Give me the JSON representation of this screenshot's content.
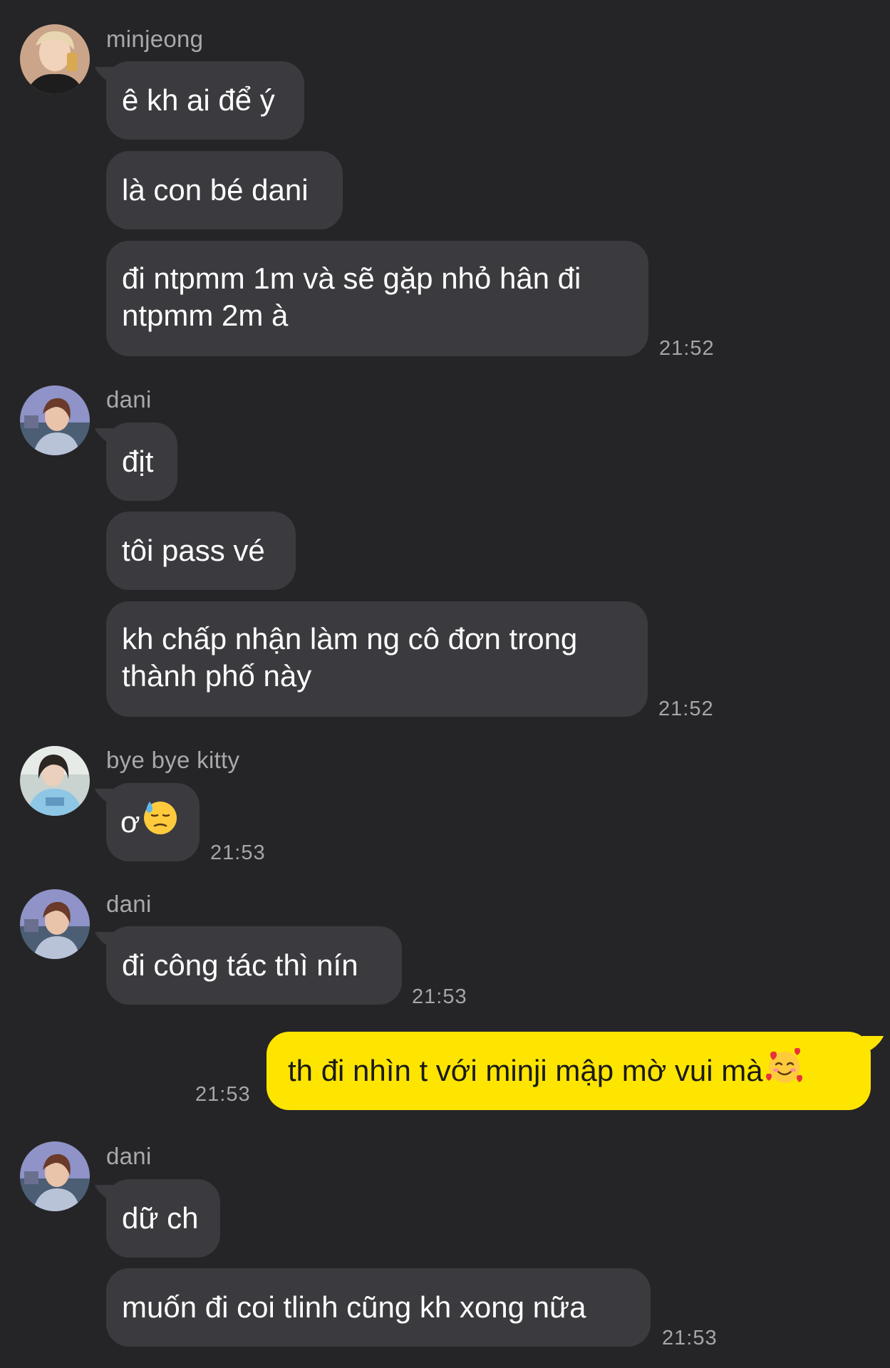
{
  "messages": {
    "g1": {
      "sender": "minjeong",
      "b1": "ê kh ai để ý",
      "b2": "là con bé dani",
      "b3": "đi ntpmm 1m và sẽ gặp nhỏ hân đi ntpmm 2m à",
      "time": "21:52"
    },
    "g2": {
      "sender": "dani",
      "b1": "địt",
      "b2": "tôi pass vé",
      "b3": "kh chấp nhận làm ng cô đơn trong thành phố này",
      "time": "21:52"
    },
    "g3": {
      "sender": "bye bye kitty",
      "b1": "ơ",
      "b1_emoji": "downcast-face-with-sweat-emoji",
      "time": "21:53"
    },
    "g4": {
      "sender": "dani",
      "b1": "đi công tác thì nín",
      "time": "21:53"
    },
    "g5": {
      "b1": "th đi nhìn t với minji mập mờ vui mà",
      "b1_emoji": "smiling-face-with-hearts-emoji",
      "time": "21:53"
    },
    "g6": {
      "sender": "dani",
      "b1": "dữ ch",
      "b2": "muốn đi coi tlinh cũng kh xong nữa",
      "time": "21:53"
    }
  },
  "colors": {
    "background": "#252527",
    "bubble_incoming": "#3b3b3f",
    "bubble_outgoing": "#fee500",
    "name_text": "#a9a9ad",
    "time_text": "#a6a6aa"
  }
}
